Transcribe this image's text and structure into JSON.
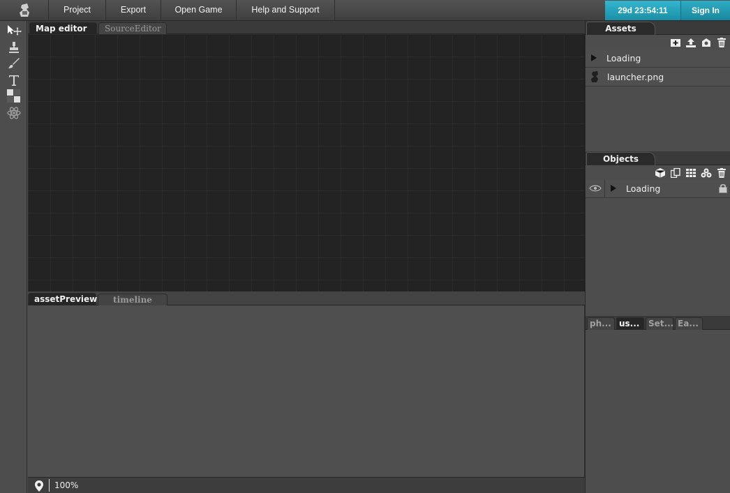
{
  "menu": {
    "items": [
      {
        "label": "Project"
      },
      {
        "label": "Export"
      },
      {
        "label": "Open Game"
      },
      {
        "label": "Help and Support"
      }
    ],
    "timer": "29d 23:54:11",
    "signin": "Sign In"
  },
  "editor_tabs": [
    "Map editor",
    "SourceEditor"
  ],
  "bottom_tabs": [
    "assetPreview",
    "timeline"
  ],
  "status": {
    "zoom": "100%"
  },
  "assets": {
    "title": "Assets",
    "items": [
      {
        "label": "Loading",
        "icon": "expand-triangle-icon"
      },
      {
        "label": "launcher.png",
        "icon": "image-file-icon"
      }
    ]
  },
  "objects": {
    "title": "Objects",
    "items": [
      {
        "label": "Loading"
      }
    ]
  },
  "props_tabs": [
    "ph...",
    "us...",
    "Set...",
    "Ea..."
  ],
  "colors": {
    "accent": "#2aa8c2",
    "grid_bg": "#232323"
  }
}
